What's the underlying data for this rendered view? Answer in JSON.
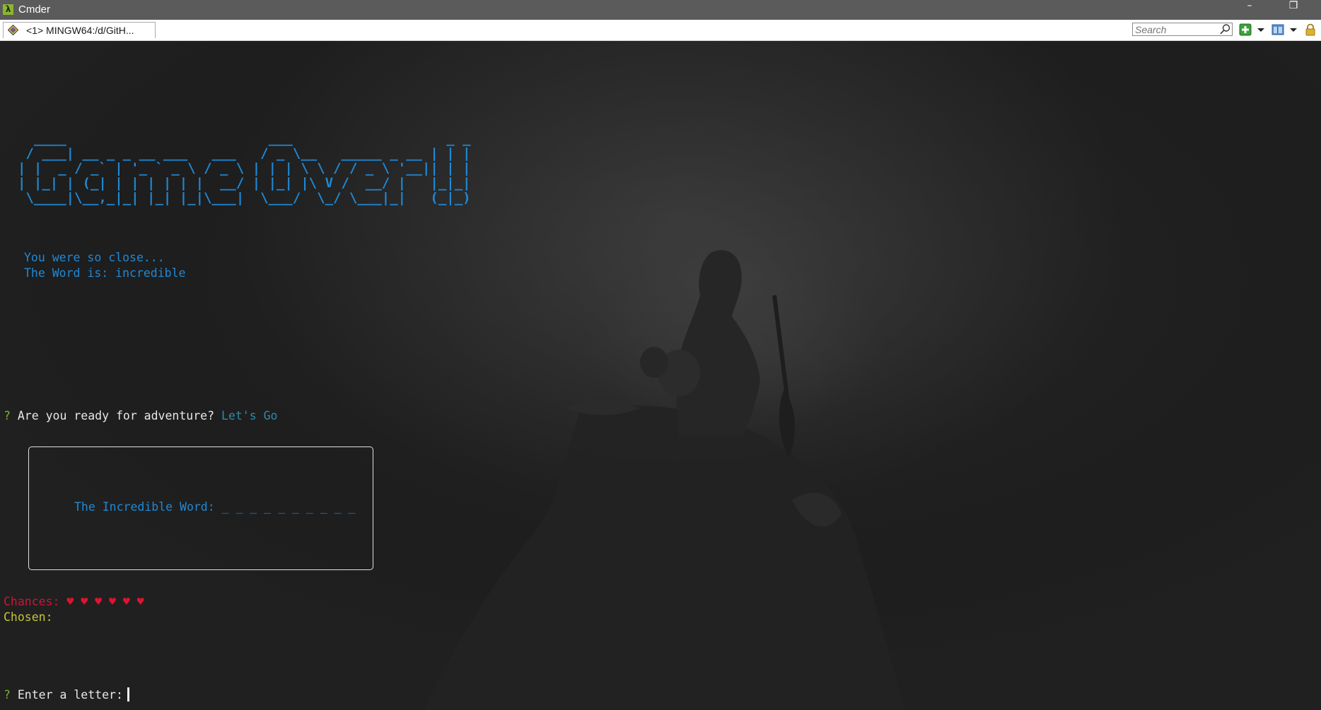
{
  "window": {
    "app_icon": "lambda-icon",
    "title": "Cmder",
    "controls": {
      "minimize_glyph": "–",
      "restore_glyph": "❐"
    }
  },
  "tabbar": {
    "tab_label": "<1> MINGW64:/d/GitH...",
    "search_placeholder": "Search",
    "icons": [
      "tab-console-icon",
      "search-icon",
      "new-console-icon",
      "dropdown-icon",
      "view-icon",
      "dropdown-icon",
      "lock-icon"
    ]
  },
  "terminal": {
    "ascii_art": "  ____                         ___                   _ _\n / ___| __ _ _ __ ___   ___   / _ \\__   _____ _ __ | | |\n| |  _ / _` | '_ ` _ \\ / _ \\ | | | \\ \\ / / _ \\ '__|| | |\n| |_| | (_| | | | | | |  __/ | |_| |\\ V /  __/ |   |_|_|\n \\____|\\__,_|_| |_| |_|\\___|  \\___/  \\_/ \\___|_|   (_|_)",
    "message_line1": "You were so close...",
    "message_line2": "The Word is: incredible",
    "prompt_symbol": "?",
    "adventure_question": "Are you ready for adventure?",
    "adventure_answer": "Let's Go",
    "word_box_label": "The Incredible Word:",
    "word_blanks": "_ _ _ _ _ _ _ _ _ _",
    "chances_label": "Chances:",
    "chances_hearts": "♥ ♥ ♥ ♥ ♥ ♥",
    "chances_count": 6,
    "chosen_label": "Chosen:",
    "chosen_value": "",
    "letter_prompt": "Enter a letter:",
    "letter_input": ""
  },
  "colors": {
    "titlebar": "#5b5b5b",
    "ascii_blue": "#1f89d6",
    "prompt_green": "#7ab02a",
    "answer_teal": "#2f8aa6",
    "chances_red": "#c8173a",
    "chosen_yellow": "#c8c23a"
  }
}
